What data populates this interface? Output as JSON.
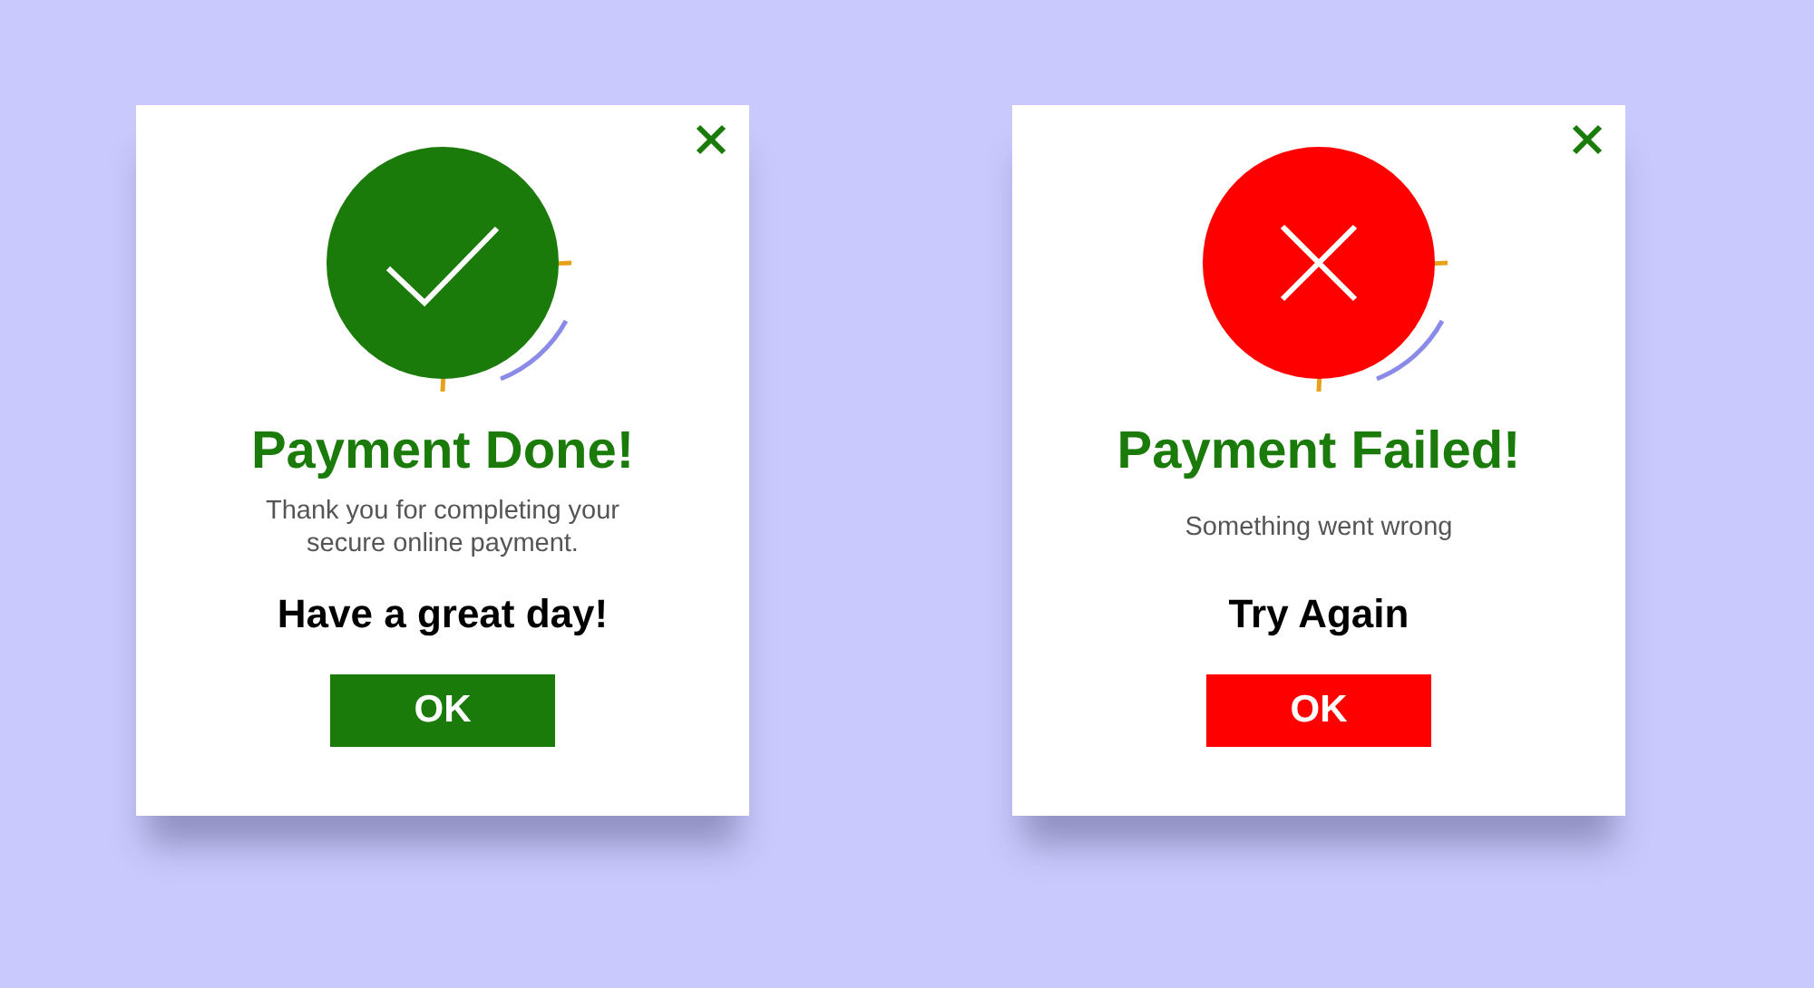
{
  "dialogs": [
    {
      "kind": "success",
      "title": "Payment Done!",
      "message": "Thank you for completing your secure online payment.",
      "headline": "Have a great day!",
      "button": "OK"
    },
    {
      "kind": "failure",
      "title": "Payment Failed!",
      "message": "Something went wrong",
      "headline": "Try Again",
      "button": "OK"
    }
  ]
}
